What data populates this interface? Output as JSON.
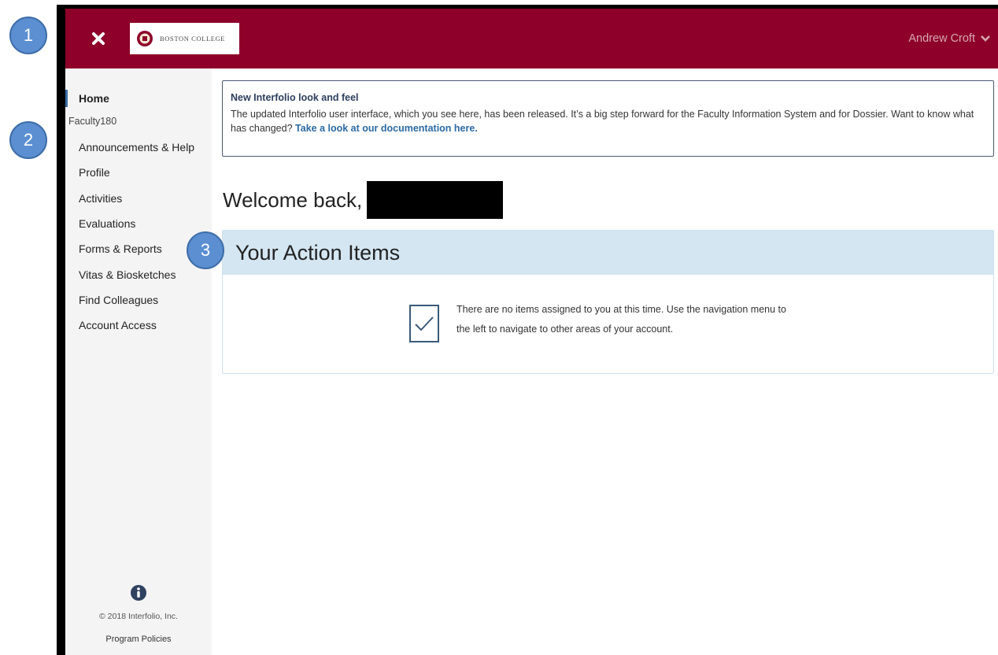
{
  "callouts": [
    "1",
    "2",
    "3"
  ],
  "topbar": {
    "logo_text": "BOSTON COLLEGE",
    "user_name": "Andrew Croft",
    "close_icon": "close-icon",
    "dropdown_icon": "chevron-down-icon",
    "bg_color": "#8e0029"
  },
  "sidebar": {
    "home_label": "Home",
    "section_label": "Faculty180",
    "items": [
      {
        "label": "Announcements & Help"
      },
      {
        "label": "Profile"
      },
      {
        "label": "Activities"
      },
      {
        "label": "Evaluations"
      },
      {
        "label": "Forms & Reports"
      },
      {
        "label": "Vitas & Biosketches"
      },
      {
        "label": "Find Colleagues"
      },
      {
        "label": "Account Access"
      }
    ],
    "footer": {
      "info_icon": "info-icon",
      "copyright": "© 2018 Interfolio, Inc.",
      "policies": "Program Policies"
    }
  },
  "banner": {
    "title": "New Interfolio look and feel",
    "body": "The updated Interfolio user interface, which you see here, has been released. It’s a big step forward for the Faculty Information System and for Dossier. Want to know what has changed?",
    "link_text": "Take a look at our documentation here."
  },
  "welcome": {
    "text": "Welcome back,"
  },
  "action_items": {
    "title": "Your Action Items",
    "empty_message": "There are no items assigned to you at this time. Use the navigation menu to the left to navigate to other areas of your account.",
    "header_color": "#d4e6f2"
  }
}
